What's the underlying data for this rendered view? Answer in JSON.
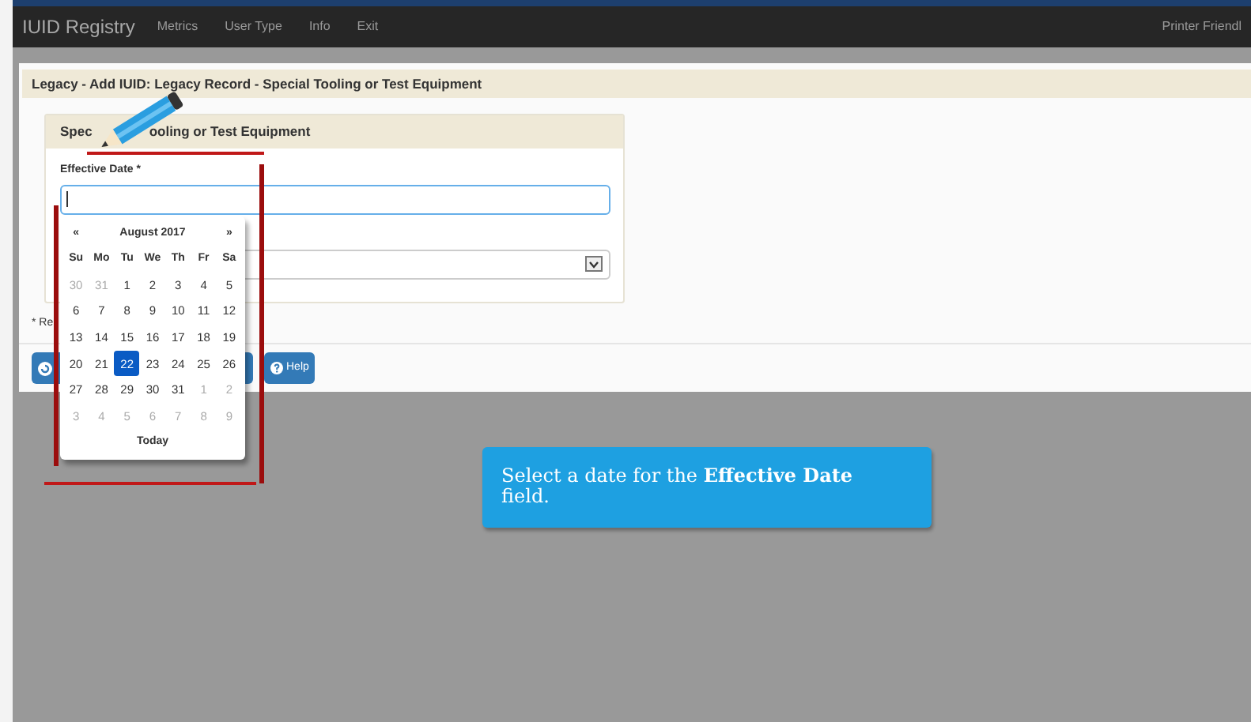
{
  "navbar": {
    "brand": "IUID Registry",
    "menu": [
      "Metrics",
      "User Type",
      "Info",
      "Exit"
    ],
    "right_link": "Printer Friendl"
  },
  "page_title": "Legacy - Add IUID: Legacy Record - Special Tooling or Test Equipment",
  "section": {
    "title_parts": [
      "Spec",
      "ooling or Test Equipment"
    ],
    "field_label": "Effective Date *",
    "field_focused": true,
    "required_note": "* Re"
  },
  "buttons": [
    {
      "kind": "icon_only"
    },
    {
      "kind": "help",
      "label": "Help"
    }
  ],
  "calendar": {
    "prev": "«",
    "month": "August 2017",
    "next": "»",
    "weekdays": [
      "Su",
      "Mo",
      "Tu",
      "We",
      "Th",
      "Fr",
      "Sa"
    ],
    "weeks": [
      [
        {
          "day": "30",
          "muted": true,
          "selected": false
        },
        {
          "day": "31",
          "muted": true,
          "selected": false
        },
        {
          "day": "1",
          "muted": false,
          "selected": false
        },
        {
          "day": "2",
          "muted": false,
          "selected": false
        },
        {
          "day": "3",
          "muted": false,
          "selected": false
        },
        {
          "day": "4",
          "muted": false,
          "selected": false
        },
        {
          "day": "5",
          "muted": false,
          "selected": false
        }
      ],
      [
        {
          "day": "6",
          "muted": false,
          "selected": false
        },
        {
          "day": "7",
          "muted": false,
          "selected": false
        },
        {
          "day": "8",
          "muted": false,
          "selected": false
        },
        {
          "day": "9",
          "muted": false,
          "selected": false
        },
        {
          "day": "10",
          "muted": false,
          "selected": false
        },
        {
          "day": "11",
          "muted": false,
          "selected": false
        },
        {
          "day": "12",
          "muted": false,
          "selected": false
        }
      ],
      [
        {
          "day": "13",
          "muted": false,
          "selected": false
        },
        {
          "day": "14",
          "muted": false,
          "selected": false
        },
        {
          "day": "15",
          "muted": false,
          "selected": false
        },
        {
          "day": "16",
          "muted": false,
          "selected": false
        },
        {
          "day": "17",
          "muted": false,
          "selected": false
        },
        {
          "day": "18",
          "muted": false,
          "selected": false
        },
        {
          "day": "19",
          "muted": false,
          "selected": false
        }
      ],
      [
        {
          "day": "20",
          "muted": false,
          "selected": false
        },
        {
          "day": "21",
          "muted": false,
          "selected": false
        },
        {
          "day": "22",
          "muted": false,
          "selected": true
        },
        {
          "day": "23",
          "muted": false,
          "selected": false
        },
        {
          "day": "24",
          "muted": false,
          "selected": false
        },
        {
          "day": "25",
          "muted": false,
          "selected": false
        },
        {
          "day": "26",
          "muted": false,
          "selected": false
        }
      ],
      [
        {
          "day": "27",
          "muted": false,
          "selected": false
        },
        {
          "day": "28",
          "muted": false,
          "selected": false
        },
        {
          "day": "29",
          "muted": false,
          "selected": false
        },
        {
          "day": "30",
          "muted": false,
          "selected": false
        },
        {
          "day": "31",
          "muted": false,
          "selected": false
        },
        {
          "day": "1",
          "muted": true,
          "selected": false
        },
        {
          "day": "2",
          "muted": true,
          "selected": false
        }
      ],
      [
        {
          "day": "3",
          "muted": true,
          "selected": false
        },
        {
          "day": "4",
          "muted": true,
          "selected": false
        },
        {
          "day": "5",
          "muted": true,
          "selected": false
        },
        {
          "day": "6",
          "muted": true,
          "selected": false
        },
        {
          "day": "7",
          "muted": true,
          "selected": false
        },
        {
          "day": "8",
          "muted": true,
          "selected": false
        },
        {
          "day": "9",
          "muted": true,
          "selected": false
        }
      ]
    ],
    "today": "Today"
  },
  "callout": {
    "text": "Select a date for the **Effective Date** field."
  }
}
